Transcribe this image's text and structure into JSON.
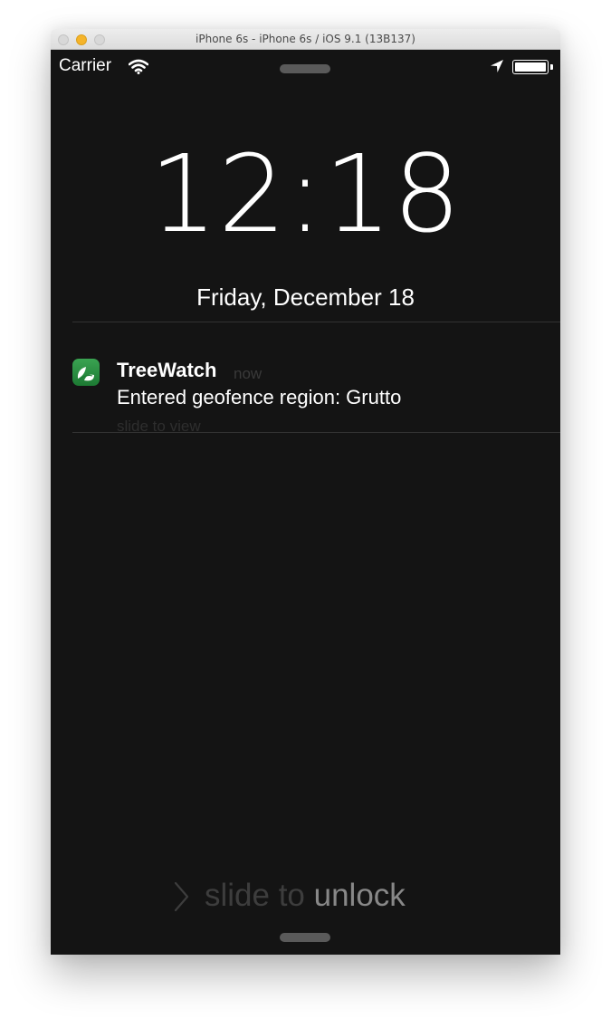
{
  "window": {
    "title": "iPhone 6s - iPhone 6s / iOS 9.1 (13B137)"
  },
  "status_bar": {
    "carrier": "Carrier",
    "icons": [
      "wifi-icon",
      "location-arrow-icon",
      "battery-icon"
    ]
  },
  "lock_screen": {
    "time": "12:18",
    "date": "Friday, December 18"
  },
  "notification": {
    "app_icon": "treewatch-leaf-icon",
    "app_name": "TreeWatch",
    "time": "now",
    "message": "Entered geofence region: Grutto",
    "hint": "slide to view"
  },
  "unlock": {
    "text_dim": "slide to ",
    "text_bright": "unlock"
  },
  "colors": {
    "screen_background": "#141414",
    "app_icon_green": "#2e8f45"
  }
}
